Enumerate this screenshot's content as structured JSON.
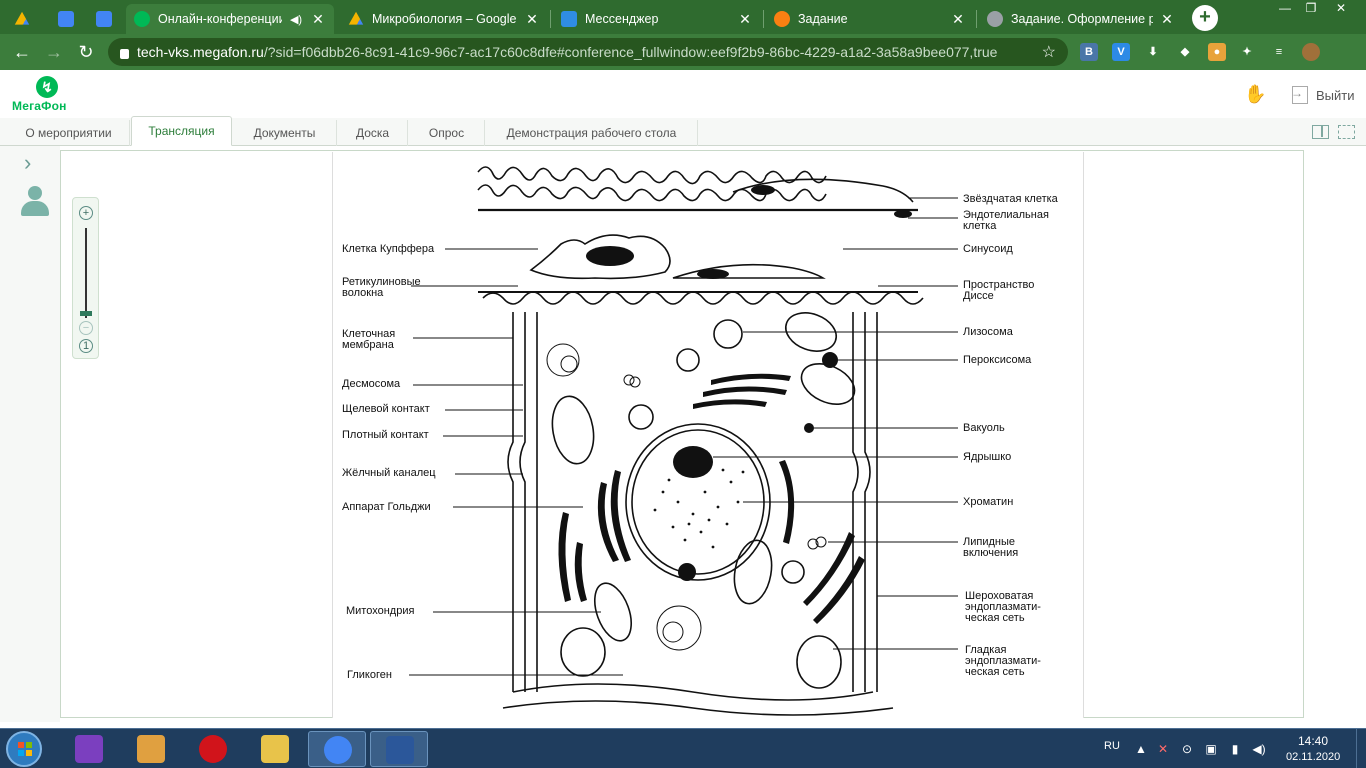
{
  "browser": {
    "tabs": [
      {
        "title": "",
        "icon": "google-drive-icon",
        "color": "#f5b400",
        "active": false
      },
      {
        "title": "",
        "icon": "google-docs-icon",
        "color": "#4285f4",
        "active": false
      },
      {
        "title": "",
        "icon": "google-docs-icon",
        "color": "#4285f4",
        "active": false
      },
      {
        "title": "Онлайн-конференции",
        "icon": "megafon-icon",
        "color": "#00b956",
        "active": true
      },
      {
        "title": "Микробиология – Google Д",
        "icon": "google-drive-icon",
        "color": "#f5b400",
        "active": false
      },
      {
        "title": "Мессенджер",
        "icon": "messenger-icon",
        "color": "#2f8de4",
        "active": false
      },
      {
        "title": "Задание",
        "icon": "moodle-icon",
        "color": "#f98012",
        "active": false
      },
      {
        "title": "Задание. Оформление реф",
        "icon": "globe-icon",
        "color": "#9aa0a6",
        "active": false
      }
    ],
    "url_host": "tech-vks.megafon.ru",
    "url_rest": "/?sid=f06dbb26-8c91-41c9-96c7-ac17c60c8dfe#conference_fullwindow:eef9f2b9-86bc-4229-a1a2-3a58a9bee077,true",
    "extensions": [
      {
        "icon": "vk-b-icon",
        "label": "B",
        "color": "#4a76a8"
      },
      {
        "icon": "vk-v-icon",
        "label": "V",
        "color": "#2d8ae6"
      },
      {
        "icon": "download-icon",
        "label": "⬇",
        "color": "#3c7d3c"
      },
      {
        "icon": "cube-icon",
        "label": "◆",
        "color": "#3c7d3c"
      },
      {
        "icon": "cookie-icon",
        "label": "●",
        "color": "#e8a33b"
      },
      {
        "icon": "puzzle-icon",
        "label": "✦",
        "color": "#3c7d3c"
      },
      {
        "icon": "playlist-icon",
        "label": "≡",
        "color": "#3c7d3c"
      },
      {
        "icon": "avatar-icon",
        "label": "",
        "color": "#a0703a"
      }
    ]
  },
  "app": {
    "logo": "МегаФон",
    "exit_label": "Выйти",
    "tabs": [
      "О мероприятии",
      "Трансляция",
      "Документы",
      "Доска",
      "Опрос",
      "Демонстрация рабочего стола"
    ],
    "active_tab": 1,
    "zoom_in": "+",
    "zoom_out": "−",
    "zoom_reset": "1"
  },
  "diagram": {
    "labels_left": [
      "Клетка Купффера",
      "Ретикулиновые\nволокна",
      "Клеточная\nмембрана",
      "Десмосома",
      "Щелевой контакт",
      "Плотный контакт",
      "Жёлчный каналец",
      "Аппарат Гольджи",
      "Митохондрия",
      "Гликоген"
    ],
    "labels_right": [
      "Звёздчатая клетка",
      "Эндотелиальная\nклетка",
      "Синусоид",
      "Пространство\nДиссе",
      "Лизосома",
      "Пероксисома",
      "Вакуоль",
      "Ядрышко",
      "Хроматин",
      "Липидные\nвключения",
      "Шероховатая\nэндоплазмати-\nческая сеть",
      "Гладкая\nэндоплазмати-\nческая сеть"
    ]
  },
  "taskbar": {
    "apps": [
      {
        "icon": "visual-studio-icon",
        "color": "#7b3fbf"
      },
      {
        "icon": "paint-icon",
        "color": "#e0a040"
      },
      {
        "icon": "opera-icon",
        "color": "#d1141b"
      },
      {
        "icon": "file-explorer-icon",
        "color": "#e8c34a"
      },
      {
        "icon": "chrome-icon",
        "color": "#4285f4"
      },
      {
        "icon": "word-icon",
        "color": "#2b579a"
      }
    ],
    "language": "RU",
    "time": "14:40",
    "date": "02.11.2020"
  }
}
